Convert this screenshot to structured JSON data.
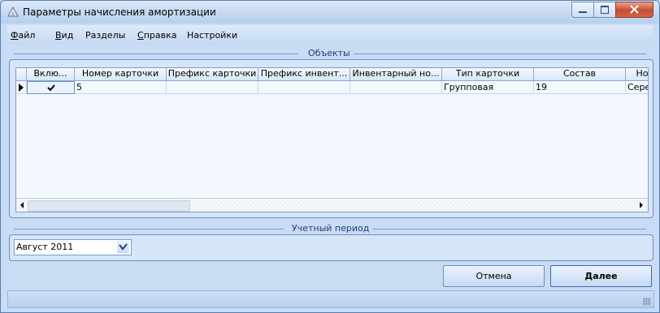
{
  "window": {
    "title": "Параметры начисления амортизации"
  },
  "menu": {
    "items": [
      {
        "label_u": "Ф",
        "label_rest": "айл"
      },
      {
        "label_u": "В",
        "label_rest": "ид"
      },
      {
        "label_u": "",
        "label_rest": "Разделы"
      },
      {
        "label_u": "С",
        "label_rest": "правка"
      },
      {
        "label_u": "",
        "label_rest": "Настройки"
      }
    ]
  },
  "objects_group": {
    "title": "Объекты",
    "columns": [
      "Вклю...",
      "Номер карточки",
      "Префикс карточки",
      "Префикс инвент...",
      "Инвентарный но...",
      "Тип карточки",
      "Состав",
      "Но"
    ],
    "rows": [
      {
        "enabled": true,
        "card_number": "5",
        "card_prefix": "",
        "inv_prefix": "",
        "inv_number": "",
        "card_type": "Групповая",
        "composition": "19",
        "extra": "Сере"
      }
    ]
  },
  "period_group": {
    "title": "Учетный период",
    "value": "Август 2011"
  },
  "buttons": {
    "cancel": "Отмена",
    "next": "Далее"
  },
  "colors": {
    "accent": "#1f3f73",
    "window_bg": "#c9dcf4",
    "grid_bg": "#f3f8ff"
  }
}
